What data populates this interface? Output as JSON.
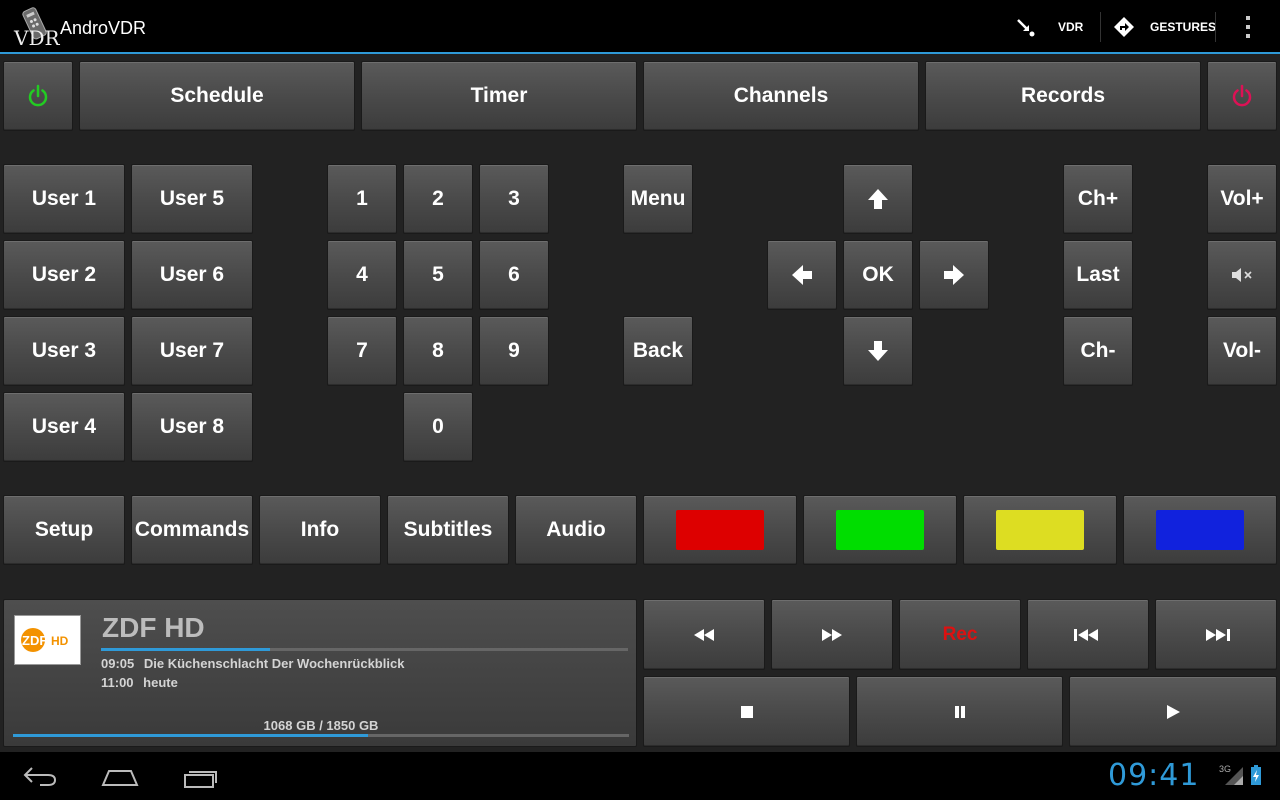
{
  "app": {
    "title": "AndroVDR",
    "logo_text": "VDR"
  },
  "actionbar": {
    "vdr_label": "VDR",
    "gestures_label": "GESTURES"
  },
  "nav": {
    "schedule": "Schedule",
    "timer": "Timer",
    "channels": "Channels",
    "records": "Records"
  },
  "user_keys": [
    "User 1",
    "User 2",
    "User 3",
    "User 4",
    "User 5",
    "User 6",
    "User 7",
    "User 8"
  ],
  "number_keys": [
    "1",
    "2",
    "3",
    "4",
    "5",
    "6",
    "7",
    "8",
    "9",
    "0"
  ],
  "dpad": {
    "menu": "Menu",
    "back": "Back",
    "ok": "OK"
  },
  "channel_keys": {
    "ch_up": "Ch+",
    "last": "Last",
    "ch_down": "Ch-"
  },
  "volume_keys": {
    "vol_up": "Vol+",
    "vol_down": "Vol-"
  },
  "function_keys": {
    "setup": "Setup",
    "commands": "Commands",
    "info": "Info",
    "subtitles": "Subtitles",
    "audio": "Audio"
  },
  "colors": {
    "accent": "#2f9ad8",
    "power_on": "#22cc22",
    "power_off": "#dd1155",
    "red_key": "#dd0000",
    "green_key": "#00dd00",
    "yellow_key": "#dddd22",
    "blue_key": "#1122dd",
    "rec": "#dd1111"
  },
  "channel": {
    "logo_text": "ZDF HD",
    "name": "ZDF HD",
    "progress": 0.32,
    "now_time": "09:05",
    "now_title": "Die Küchenschlacht Der Wochenrückblick",
    "next_time": "11:00",
    "next_title": "heute"
  },
  "disk": {
    "text": "1068 GB / 1850 GB",
    "used_fraction": 0.577
  },
  "playback": {
    "rec_label": "Rec"
  },
  "icons": [
    "power-icon",
    "arrow-up-icon",
    "arrow-left-icon",
    "arrow-right-icon",
    "arrow-down-icon",
    "mute-icon",
    "rewind-icon",
    "fast-forward-icon",
    "skip-back-icon",
    "skip-forward-icon",
    "stop-icon",
    "pause-icon",
    "play-icon",
    "back-nav-icon",
    "home-nav-icon",
    "recent-apps-icon",
    "overflow-menu-icon",
    "gestures-icon",
    "vdr-connect-icon",
    "signal-icon",
    "battery-icon"
  ],
  "status": {
    "clock": "09:41",
    "network": "3G"
  }
}
